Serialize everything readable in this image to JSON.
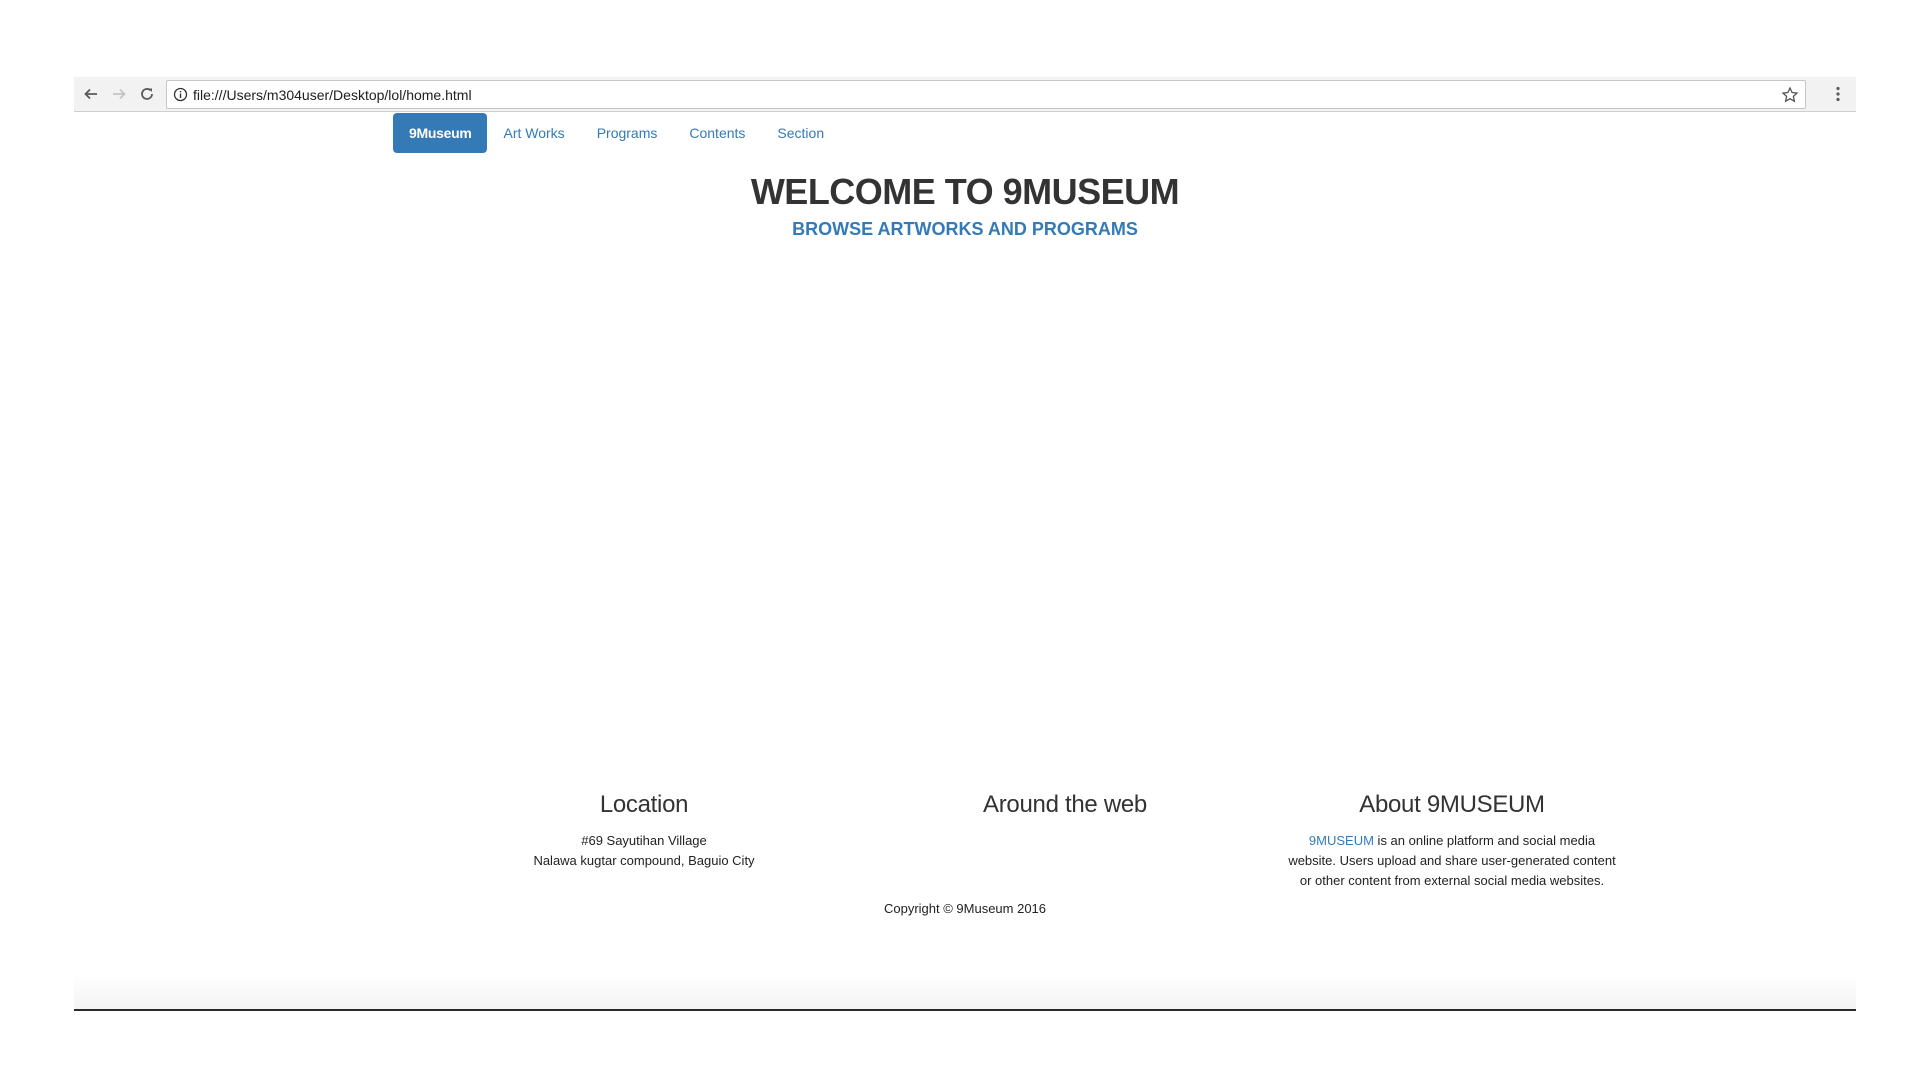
{
  "browser": {
    "url": "file:///Users/m304user/Desktop/lol/home.html"
  },
  "navbar": {
    "brand": "9Museum",
    "items": [
      {
        "label": "Art Works"
      },
      {
        "label": "Programs"
      },
      {
        "label": "Contents"
      },
      {
        "label": "Section"
      }
    ]
  },
  "hero": {
    "title": "WELCOME TO 9MUSEUM",
    "link": "BROWSE ARTWORKS AND PROGRAMS"
  },
  "footer": {
    "location": {
      "heading": "Location",
      "line1": "#69 Sayutihan Village",
      "line2": "Nalawa kugtar compound, Baguio City"
    },
    "web": {
      "heading": "Around the web"
    },
    "about": {
      "heading": "About 9MUSEUM",
      "link": "9MUSEUM",
      "text1": " is an online platform and social media",
      "text2": "website. Users upload and share user-generated content",
      "text3": "or other content from external social media websites."
    },
    "copyright": "Copyright © 9Museum 2016"
  },
  "colors": {
    "accent": "#337ab7",
    "text": "#333333"
  }
}
